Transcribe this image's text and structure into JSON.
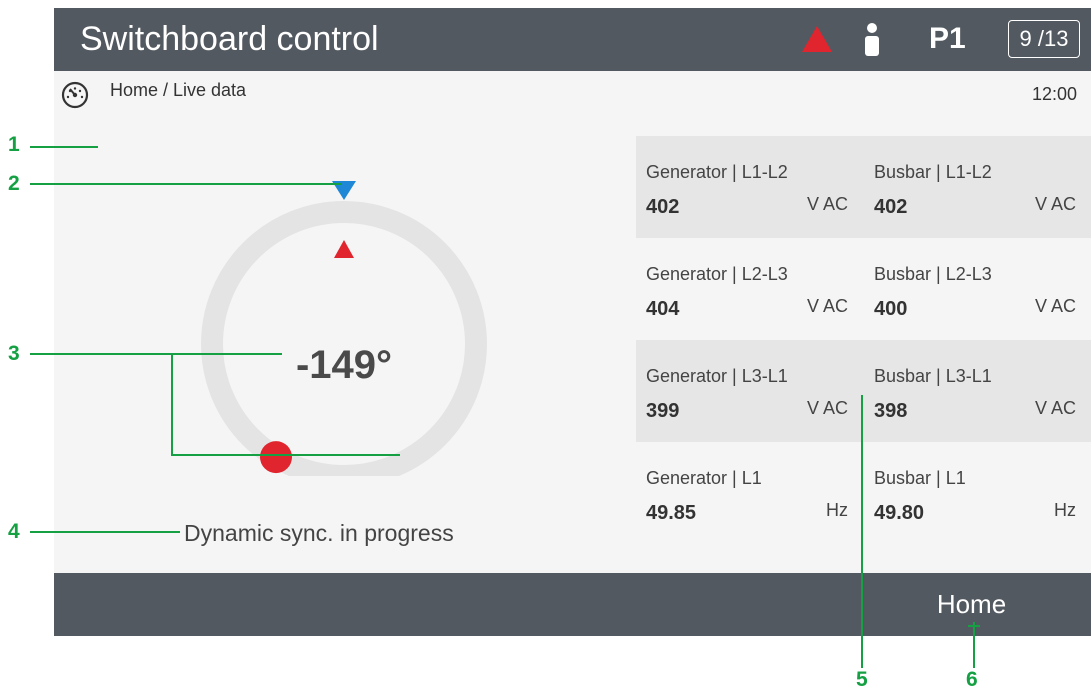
{
  "header": {
    "title": "Switchboard control",
    "page_code": "P1",
    "page_counter": "9 /13",
    "alarm_icon": "warning-triangle-icon",
    "user_icon": "user-icon",
    "alarm_color": "#e0252f"
  },
  "breadcrumb": {
    "icon": "gauge-icon",
    "text": "Home / Live data",
    "time": "12:00"
  },
  "synchroscope": {
    "angle": "-149°",
    "status": "Dynamic sync. in progress",
    "phase_angle_deg": -149,
    "reference_marker_color": "#1e88d6",
    "target_marker_color": "#e0252f",
    "indicator_color": "#e0252f",
    "ring_color": "#e4e4e4"
  },
  "measurements": [
    [
      {
        "label": "Generator | L1-L2",
        "value": "402",
        "unit": "V AC"
      },
      {
        "label": "Busbar | L1-L2",
        "value": "402",
        "unit": "V AC"
      }
    ],
    [
      {
        "label": "Generator | L2-L3",
        "value": "404",
        "unit": "V AC"
      },
      {
        "label": "Busbar | L2-L3",
        "value": "400",
        "unit": "V AC"
      }
    ],
    [
      {
        "label": "Generator | L3-L1",
        "value": "399",
        "unit": "V AC"
      },
      {
        "label": "Busbar | L3-L1",
        "value": "398",
        "unit": "V AC"
      }
    ],
    [
      {
        "label": "Generator | L1",
        "value": "49.85",
        "unit": "Hz"
      },
      {
        "label": "Busbar | L1",
        "value": "49.80",
        "unit": "Hz"
      }
    ]
  ],
  "footer": {
    "home_label": "Home"
  },
  "callouts": {
    "color": "#15a043",
    "labels": [
      "1",
      "2",
      "3",
      "4",
      "5",
      "6"
    ]
  }
}
